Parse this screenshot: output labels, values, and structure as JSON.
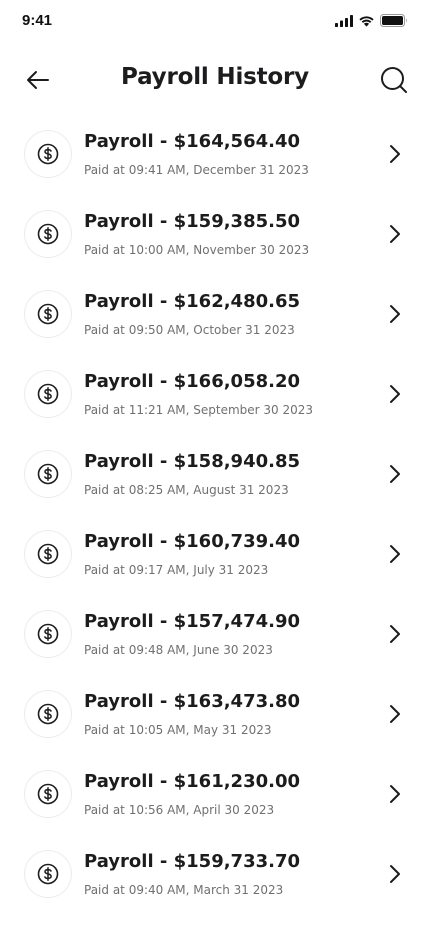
{
  "status_bar": {
    "time": "9:41",
    "icons": [
      "cellular-signal-icon",
      "wifi-icon",
      "battery-icon"
    ]
  },
  "header": {
    "title": "Payroll History",
    "back_icon": "arrow-left-icon",
    "search_icon": "search-icon"
  },
  "payrolls": [
    {
      "title": "Payroll - $164,564.40",
      "subtitle": "Paid at 09:41 AM, December 31 2023"
    },
    {
      "title": "Payroll - $159,385.50",
      "subtitle": "Paid at 10:00 AM, November 30 2023"
    },
    {
      "title": "Payroll - $162,480.65",
      "subtitle": "Paid at 09:50 AM, October 31 2023"
    },
    {
      "title": "Payroll - $166,058.20",
      "subtitle": "Paid at 11:21 AM, September 30 2023"
    },
    {
      "title": "Payroll - $158,940.85",
      "subtitle": "Paid at 08:25 AM, August 31 2023"
    },
    {
      "title": "Payroll - $160,739.40",
      "subtitle": "Paid at 09:17 AM, July 31 2023"
    },
    {
      "title": "Payroll - $157,474.90",
      "subtitle": "Paid at 09:48 AM, June 30 2023"
    },
    {
      "title": "Payroll - $163,473.80",
      "subtitle": "Paid at 10:05 AM, May 31 2023"
    },
    {
      "title": "Payroll - $161,230.00",
      "subtitle": "Paid at 10:56 AM, April 30 2023"
    },
    {
      "title": "Payroll - $159,733.70",
      "subtitle": "Paid at 09:40 AM, March 31 2023"
    }
  ],
  "item_icons": {
    "leading": "dollar-coin-icon",
    "trailing": "chevron-right-icon"
  },
  "colors": {
    "text_primary": "#1c1c1e",
    "text_secondary": "#707070",
    "background": "#ffffff"
  }
}
